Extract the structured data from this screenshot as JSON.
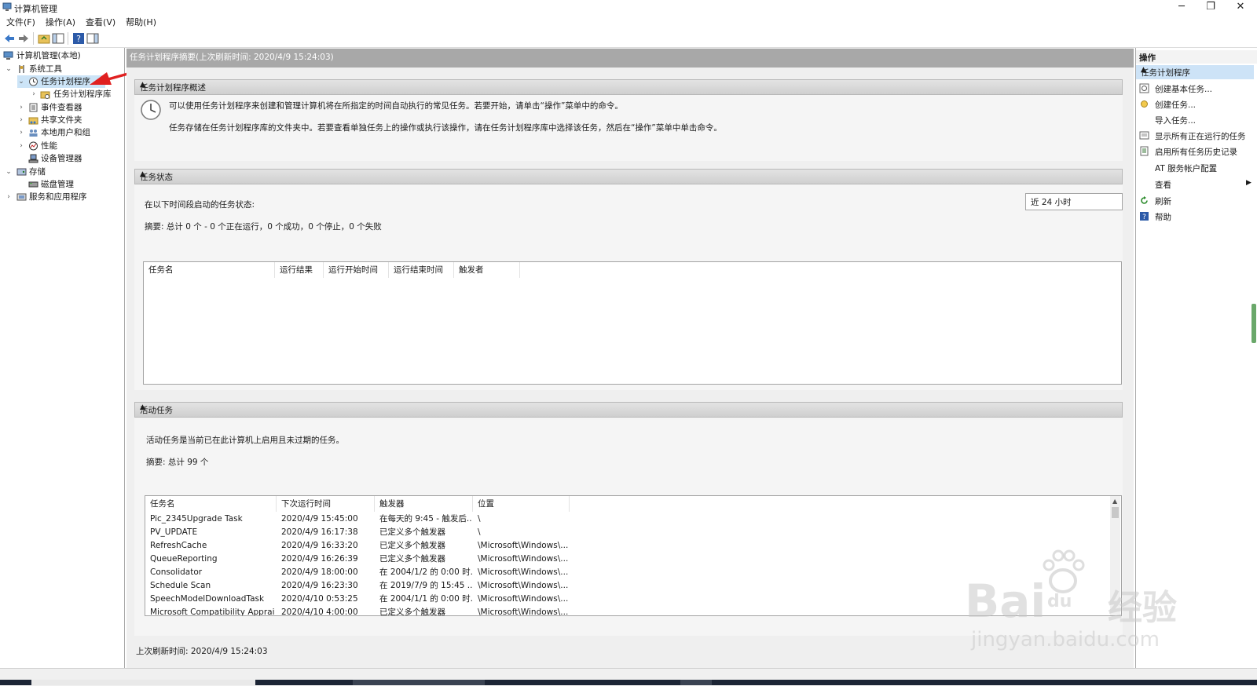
{
  "window": {
    "title": "计算机管理",
    "controls": {
      "minimize": "─",
      "restore": "❐",
      "close": "✕"
    }
  },
  "menu": [
    "文件(F)",
    "操作(A)",
    "查看(V)",
    "帮助(H)"
  ],
  "tree": [
    {
      "label": "计算机管理(本地)",
      "icon": "computer-management-icon"
    },
    {
      "label": "系统工具",
      "icon": "system-tools-icon"
    },
    {
      "label": "任务计划程序",
      "icon": "clock-icon"
    },
    {
      "label": "任务计划程序库",
      "icon": "folder-icon"
    },
    {
      "label": "事件查看器",
      "icon": "event-viewer-icon"
    },
    {
      "label": "共享文件夹",
      "icon": "shared-folder-icon"
    },
    {
      "label": "本地用户和组",
      "icon": "users-icon"
    },
    {
      "label": "性能",
      "icon": "performance-icon"
    },
    {
      "label": "设备管理器",
      "icon": "device-manager-icon"
    },
    {
      "label": "存储",
      "icon": "storage-icon"
    },
    {
      "label": "磁盘管理",
      "icon": "disk-icon"
    },
    {
      "label": "服务和应用程序",
      "icon": "services-icon"
    }
  ],
  "center": {
    "header": "任务计划程序摘要(上次刷新时间: 2020/4/9 15:24:03)",
    "overview": {
      "title": "任务计划程序概述",
      "line1": "可以使用任务计划程序来创建和管理计算机将在所指定的时间自动执行的常见任务。若要开始，请单击“操作”菜单中的命令。",
      "line2": "任务存储在任务计划程序库的文件夹中。若要查看单独任务上的操作或执行该操作，请在任务计划程序库中选择该任务，然后在“操作”菜单中单击命令。"
    },
    "status": {
      "title": "任务状态",
      "label": "在以下时间段启动的任务状态:",
      "period": "近 24 小时",
      "summary": "摘要: 总计 0 个 - 0 个正在运行，0 个成功，0 个停止，0 个失败",
      "columns": [
        "任务名",
        "运行结果",
        "运行开始时间",
        "运行结束时间",
        "触发者"
      ]
    },
    "active": {
      "title": "活动任务",
      "desc": "活动任务是当前已在此计算机上启用且未过期的任务。",
      "summary": "摘要: 总计 99 个",
      "columns": [
        "任务名",
        "下次运行时间",
        "触发器",
        "位置"
      ],
      "rows": [
        [
          "Pic_2345Upgrade Task",
          "2020/4/9 15:45:00",
          "在每天的 9:45 - 触发后...",
          "\\"
        ],
        [
          "PV_UPDATE",
          "2020/4/9 16:17:38",
          "已定义多个触发器",
          "\\"
        ],
        [
          "RefreshCache",
          "2020/4/9 16:33:20",
          "已定义多个触发器",
          "\\Microsoft\\Windows\\..."
        ],
        [
          "QueueReporting",
          "2020/4/9 16:26:39",
          "已定义多个触发器",
          "\\Microsoft\\Windows\\..."
        ],
        [
          "Consolidator",
          "2020/4/9 18:00:00",
          "在 2004/1/2 的 0:00 时...",
          "\\Microsoft\\Windows\\..."
        ],
        [
          "Schedule Scan",
          "2020/4/9 16:23:30",
          "在 2019/7/9 的 15:45 ...",
          "\\Microsoft\\Windows\\..."
        ],
        [
          "SpeechModelDownloadTask",
          "2020/4/10 0:53:25",
          "在 2004/1/1 的 0:00 时...",
          "\\Microsoft\\Windows\\..."
        ],
        [
          "Microsoft Compatibility Apprai...",
          "2020/4/10 4:00:00",
          "已定义多个触发器",
          "\\Microsoft\\Windows\\..."
        ]
      ]
    },
    "footer": "上次刷新时间: 2020/4/9 15:24:03"
  },
  "actions": {
    "title": "操作",
    "section": "任务计划程序",
    "items": [
      {
        "label": "创建基本任务...",
        "icon": "create-basic-task-icon"
      },
      {
        "label": "创建任务...",
        "icon": "create-task-icon"
      },
      {
        "label": "导入任务...",
        "icon": ""
      },
      {
        "label": "显示所有正在运行的任务",
        "icon": "running-tasks-icon"
      },
      {
        "label": "启用所有任务历史记录",
        "icon": "history-icon"
      },
      {
        "label": "AT 服务帐户配置",
        "icon": ""
      },
      {
        "label": "查看",
        "icon": ""
      },
      {
        "label": "刷新",
        "icon": "refresh-icon"
      },
      {
        "label": "帮助",
        "icon": "help-icon"
      }
    ]
  },
  "watermark": {
    "main": "Bai",
    "mid": "du",
    "cn": "经验",
    "sub": "jingyan.baidu.com"
  }
}
